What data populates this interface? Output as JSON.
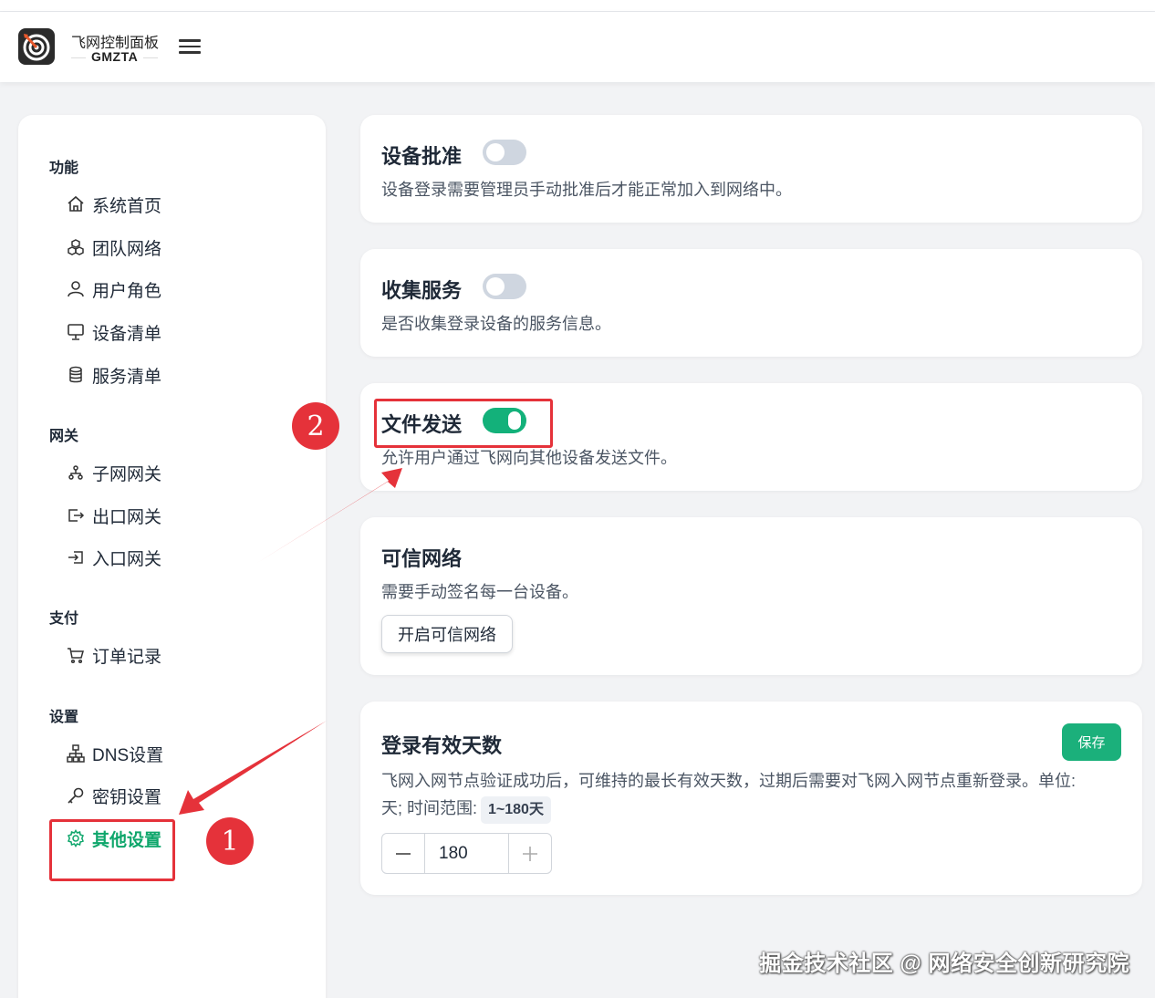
{
  "header": {
    "brand_title": "飞网控制面板",
    "brand_sub": "GMZTA"
  },
  "sidebar": {
    "groups": [
      {
        "title": "功能",
        "items": [
          {
            "label": "系统首页",
            "icon": "home-icon"
          },
          {
            "label": "团队网络",
            "icon": "cubes-icon"
          },
          {
            "label": "用户角色",
            "icon": "user-icon"
          },
          {
            "label": "设备清单",
            "icon": "monitor-icon"
          },
          {
            "label": "服务清单",
            "icon": "database-icon"
          }
        ]
      },
      {
        "title": "网关",
        "items": [
          {
            "label": "子网网关",
            "icon": "subnet-icon"
          },
          {
            "label": "出口网关",
            "icon": "exit-icon"
          },
          {
            "label": "入口网关",
            "icon": "enter-icon"
          }
        ]
      },
      {
        "title": "支付",
        "items": [
          {
            "label": "订单记录",
            "icon": "cart-icon"
          }
        ]
      },
      {
        "title": "设置",
        "items": [
          {
            "label": "DNS设置",
            "icon": "sitemap-icon"
          },
          {
            "label": "密钥设置",
            "icon": "key-icon"
          },
          {
            "label": "其他设置",
            "icon": "gear-icon",
            "active": true
          }
        ]
      }
    ]
  },
  "cards": {
    "approval": {
      "title": "设备批准",
      "desc": "设备登录需要管理员手动批准后才能正常加入到网络中。",
      "enabled": false
    },
    "collect": {
      "title": "收集服务",
      "desc": "是否收集登录设备的服务信息。",
      "enabled": false
    },
    "file_send": {
      "title": "文件发送",
      "desc": "允许用户通过飞网向其他设备发送文件。",
      "enabled": true
    },
    "trusted": {
      "title": "可信网络",
      "desc": "需要手动签名每一台设备。",
      "button": "开启可信网络"
    },
    "login_days": {
      "title": "登录有效天数",
      "desc_line1": "飞网入网节点验证成功后，可维持的最长有效天数，过期后需要对飞网入网节点重新登录。单位:",
      "desc_line2": "天; 时间范围:",
      "range": "1~180天",
      "save": "保存",
      "value": "180"
    }
  },
  "annotations": {
    "badge1": "1",
    "badge2": "2"
  },
  "watermark": "掘金技术社区 @ 网络安全创新研究院",
  "colors": {
    "accent": "#13b17a",
    "highlight": "#e5323a",
    "toggle_off": "#cfd6e0"
  }
}
